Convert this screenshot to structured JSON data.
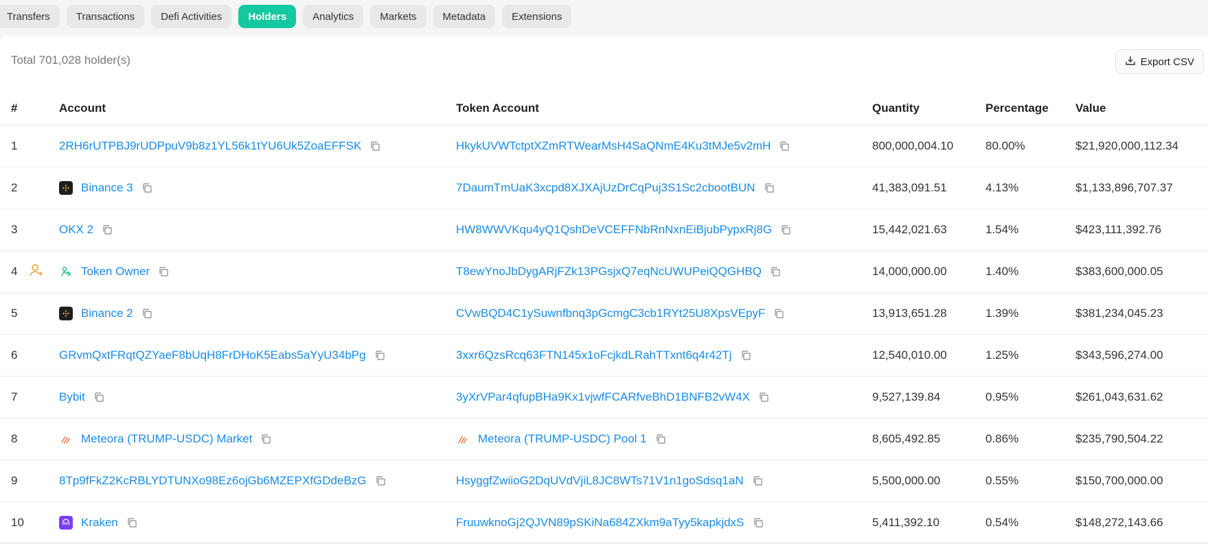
{
  "tabs": [
    {
      "label": "Transfers",
      "active": false
    },
    {
      "label": "Transactions",
      "active": false
    },
    {
      "label": "Defi Activities",
      "active": false
    },
    {
      "label": "Holders",
      "active": true
    },
    {
      "label": "Analytics",
      "active": false
    },
    {
      "label": "Markets",
      "active": false
    },
    {
      "label": "Metadata",
      "active": false
    },
    {
      "label": "Extensions",
      "active": false
    }
  ],
  "summary": {
    "total_text": "Total 701,028 holder(s)"
  },
  "export": {
    "label": "Export CSV",
    "icon": "download-icon"
  },
  "columns": {
    "rank": "#",
    "account": "Account",
    "token_account": "Token Account",
    "quantity": "Quantity",
    "percentage": "Percentage",
    "value": "Value"
  },
  "colors": {
    "accent": "#14c8a0",
    "link": "#1a8be8",
    "owner": "#f0a030"
  },
  "rows": [
    {
      "rank": "1",
      "account": "2RH6rUTPBJ9rUDPpuV9b8z1YL56k1tYU6Uk5ZoaEFFSK",
      "account_icon": "",
      "token_account": "HkykUVWTctptXZmRTWearMsH4SaQNmE4Ku3tMJe5v2mH",
      "token_icon": "",
      "quantity": "800,000,004.10",
      "percentage": "80.00%",
      "value": "$21,920,000,112.34",
      "owner": false
    },
    {
      "rank": "2",
      "account": "Binance 3",
      "account_icon": "binance-icon",
      "token_account": "7DaumTmUaK3xcpd8XJXAjUzDrCqPuj3S1Sc2cbootBUN",
      "token_icon": "",
      "quantity": "41,383,091.51",
      "percentage": "4.13%",
      "value": "$1,133,896,707.37",
      "owner": false
    },
    {
      "rank": "3",
      "account": "OKX 2",
      "account_icon": "",
      "token_account": "HW8WWVKqu4yQ1QshDeVCEFFNbRnNxnEiBjubPypxRj8G",
      "token_icon": "",
      "quantity": "15,442,021.63",
      "percentage": "1.54%",
      "value": "$423,111,392.76",
      "owner": false
    },
    {
      "rank": "4",
      "account": "Token Owner",
      "account_icon": "token-owner-icon",
      "token_account": "T8ewYnoJbDygARjFZk13PGsjxQ7eqNcUWUPeiQQGHBQ",
      "token_icon": "",
      "quantity": "14,000,000.00",
      "percentage": "1.40%",
      "value": "$383,600,000.05",
      "owner": true
    },
    {
      "rank": "5",
      "account": "Binance 2",
      "account_icon": "binance-icon",
      "token_account": "CVwBQD4C1ySuwnfbnq3pGcmgC3cb1RYt25U8XpsVEpyF",
      "token_icon": "",
      "quantity": "13,913,651.28",
      "percentage": "1.39%",
      "value": "$381,234,045.23",
      "owner": false
    },
    {
      "rank": "6",
      "account": "GRvmQxtFRqtQZYaeF8bUqH8FrDHoK5Eabs5aYyU34bPg",
      "account_icon": "",
      "token_account": "3xxr6QzsRcq63FTN145x1oFcjkdLRahTTxnt6q4r42Tj",
      "token_icon": "",
      "quantity": "12,540,010.00",
      "percentage": "1.25%",
      "value": "$343,596,274.00",
      "owner": false
    },
    {
      "rank": "7",
      "account": "Bybit",
      "account_icon": "",
      "token_account": "3yXrVPar4qfupBHa9Kx1vjwfFCARfveBhD1BNFB2vW4X",
      "token_icon": "",
      "quantity": "9,527,139.84",
      "percentage": "0.95%",
      "value": "$261,043,631.62",
      "owner": false
    },
    {
      "rank": "8",
      "account": "Meteora (TRUMP-USDC) Market",
      "account_icon": "meteora-icon",
      "token_account": "Meteora (TRUMP-USDC) Pool 1",
      "token_icon": "meteora-icon",
      "quantity": "8,605,492.85",
      "percentage": "0.86%",
      "value": "$235,790,504.22",
      "owner": false
    },
    {
      "rank": "9",
      "account": "8Tp9fFkZ2KcRBLYDTUNXo98Ez6ojGb6MZEPXfGDdeBzG",
      "account_icon": "",
      "token_account": "HsyggfZwiioG2DqUVdVjiL8JC8WTs71V1n1goSdsq1aN",
      "token_icon": "",
      "quantity": "5,500,000.00",
      "percentage": "0.55%",
      "value": "$150,700,000.00",
      "owner": false
    },
    {
      "rank": "10",
      "account": "Kraken",
      "account_icon": "kraken-icon",
      "token_account": "FruuwknoGj2QJVN89pSKiNa684ZXkm9aTyy5kapkjdxS",
      "token_icon": "",
      "quantity": "5,411,392.10",
      "percentage": "0.54%",
      "value": "$148,272,143.66",
      "owner": false
    }
  ]
}
